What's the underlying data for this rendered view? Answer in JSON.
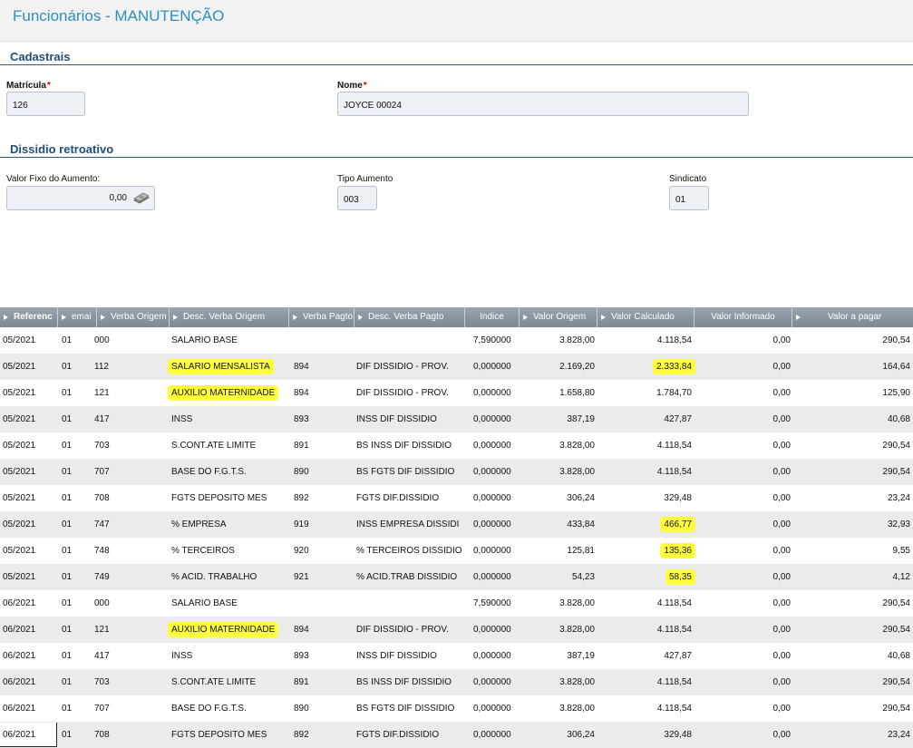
{
  "header": {
    "title": "Funcionários - MANUTENÇÃO"
  },
  "cadastrais": {
    "section_title": "Cadastrais",
    "matricula_label": "Matrícula",
    "matricula_value": "126",
    "nome_label": "Nome",
    "nome_value": "JOYCE 00024",
    "required_mark": "*"
  },
  "dissidio": {
    "section_title": "Dissidio retroativo",
    "valor_fixo_label": "Valor Fixo do Aumento:",
    "valor_fixo_value": "0,00",
    "tipo_aumento_label": "Tipo Aumento",
    "tipo_aumento_value": "003",
    "sindicato_label": "Sindicato",
    "sindicato_value": "01"
  },
  "grid": {
    "columns": [
      "Referenc",
      "emai",
      "Verba Origem",
      "Desc. Verba Origem",
      "Verba Pagto",
      "Desc. Verba Pagto",
      "Indice",
      "Valor Origem",
      "Valor Calculado",
      "Valor Informado",
      "Valor a pagar"
    ],
    "rows": [
      [
        "05/2021",
        "01",
        "000",
        "SALARIO BASE",
        "",
        "",
        "7,590000",
        "3.828,00",
        "4.118,54",
        "0,00",
        "290,54"
      ],
      [
        "05/2021",
        "01",
        "112",
        "SALARIO MENSALISTA",
        "894",
        "DIF DISSIDIO - PROV.",
        "0,000000",
        "2.169,20",
        "2.333,84",
        "0,00",
        "164,64"
      ],
      [
        "05/2021",
        "01",
        "121",
        "AUXILIO MATERNIDADE",
        "894",
        "DIF DISSIDIO - PROV.",
        "0,000000",
        "1.658,80",
        "1.784,70",
        "0,00",
        "125,90"
      ],
      [
        "05/2021",
        "01",
        "417",
        "INSS",
        "893",
        "INSS DIF DISSIDIO",
        "0,000000",
        "387,19",
        "427,87",
        "0,00",
        "40,68"
      ],
      [
        "05/2021",
        "01",
        "703",
        "S.CONT.ATE LIMITE",
        "891",
        "BS INSS DIF DISSIDIO",
        "0,000000",
        "3.828,00",
        "4.118,54",
        "0,00",
        "290,54"
      ],
      [
        "05/2021",
        "01",
        "707",
        "BASE DO F.G.T.S.",
        "890",
        "BS FGTS DIF DISSIDIO",
        "0,000000",
        "3.828,00",
        "4.118,54",
        "0,00",
        "290,54"
      ],
      [
        "05/2021",
        "01",
        "708",
        "FGTS DEPOSITO MES",
        "892",
        "FGTS DIF.DISSIDIO",
        "0,000000",
        "306,24",
        "329,48",
        "0,00",
        "23,24"
      ],
      [
        "05/2021",
        "01",
        "747",
        "% EMPRESA",
        "919",
        "INSS EMPRESA DISSIDI",
        "0,000000",
        "433,84",
        "466,77",
        "0,00",
        "32,93"
      ],
      [
        "05/2021",
        "01",
        "748",
        "% TERCEIROS",
        "920",
        "% TERCEIROS DISSIDIO",
        "0,000000",
        "125,81",
        "135,36",
        "0,00",
        "9,55"
      ],
      [
        "05/2021",
        "01",
        "749",
        "% ACID. TRABALHO",
        "921",
        "% ACID.TRAB DISSIDIO",
        "0,000000",
        "54,23",
        "58,35",
        "0,00",
        "4,12"
      ],
      [
        "06/2021",
        "01",
        "000",
        "SALARIO BASE",
        "",
        "",
        "7,590000",
        "3.828,00",
        "4.118,54",
        "0,00",
        "290,54"
      ],
      [
        "06/2021",
        "01",
        "121",
        "AUXILIO MATERNIDADE",
        "894",
        "DIF DISSIDIO - PROV.",
        "0,000000",
        "3.828,00",
        "4.118,54",
        "0,00",
        "290,54"
      ],
      [
        "06/2021",
        "01",
        "417",
        "INSS",
        "893",
        "INSS DIF DISSIDIO",
        "0,000000",
        "387,19",
        "427,87",
        "0,00",
        "40,68"
      ],
      [
        "06/2021",
        "01",
        "703",
        "S.CONT.ATE LIMITE",
        "891",
        "BS INSS DIF DISSIDIO",
        "0,000000",
        "3.828,00",
        "4.118,54",
        "0,00",
        "290,54"
      ],
      [
        "06/2021",
        "01",
        "707",
        "BASE DO F.G.T.S.",
        "890",
        "BS FGTS DIF DISSIDIO",
        "0,000000",
        "3.828,00",
        "4.118,54",
        "0,00",
        "290,54"
      ],
      [
        "06/2021",
        "01",
        "708",
        "FGTS DEPOSITO MES",
        "892",
        "FGTS DIF.DISSIDIO",
        "0,000000",
        "306,24",
        "329,48",
        "0,00",
        "23,24"
      ]
    ],
    "highlights": [
      [
        1,
        3
      ],
      [
        1,
        8
      ],
      [
        2,
        3
      ],
      [
        7,
        8
      ],
      [
        8,
        8
      ],
      [
        9,
        8
      ],
      [
        11,
        3
      ]
    ],
    "highlight_color": "#ffff3a",
    "selected_row": 15
  }
}
